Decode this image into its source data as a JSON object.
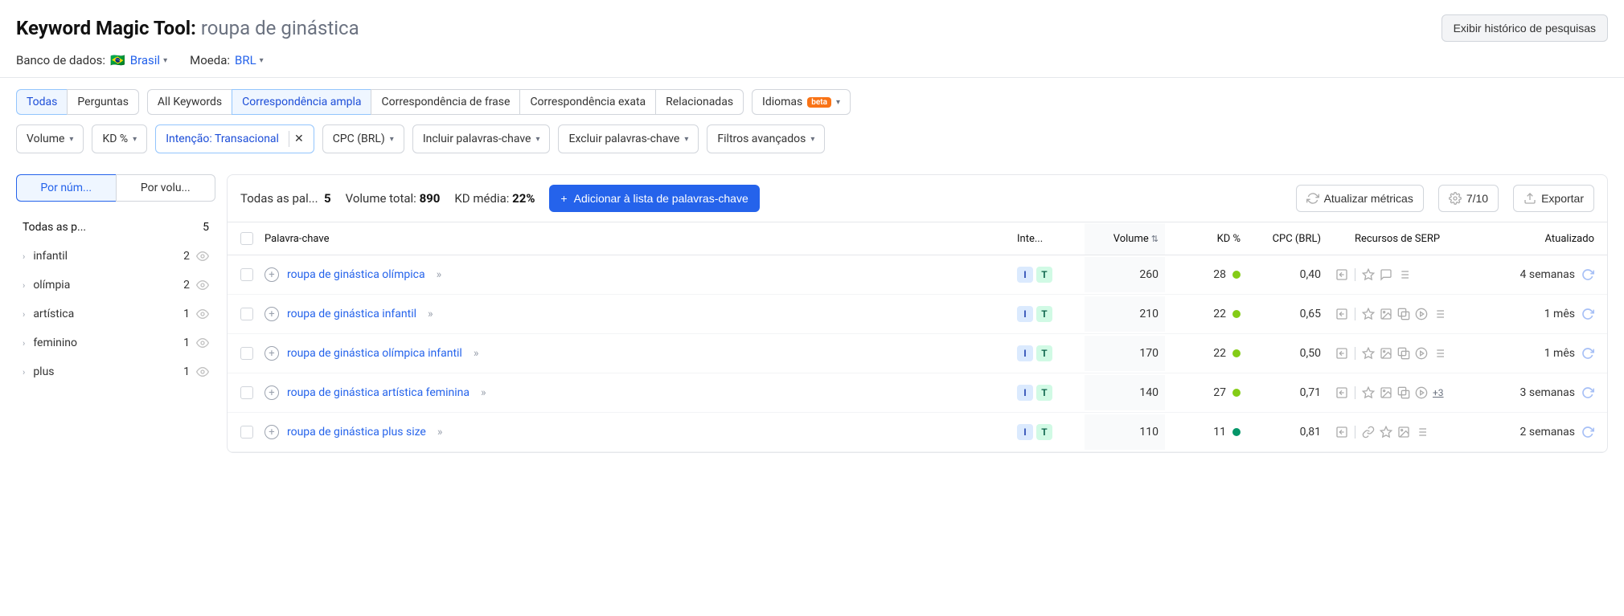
{
  "header": {
    "tool_name": "Keyword Magic Tool:",
    "query": "roupa de ginástica",
    "history_button": "Exibir histórico de pesquisas",
    "db_label": "Banco de dados:",
    "db_value": "Brasil",
    "db_flag": "🇧🇷",
    "currency_label": "Moeda:",
    "currency_value": "BRL"
  },
  "filter_tabs": {
    "todas": "Todas",
    "perguntas": "Perguntas",
    "all_keywords": "All Keywords",
    "ampla": "Correspondência ampla",
    "frase": "Correspondência de frase",
    "exata": "Correspondência exata",
    "relacionadas": "Relacionadas",
    "idiomas": "Idiomas",
    "beta": "beta"
  },
  "filters2": {
    "volume": "Volume",
    "kd": "KD %",
    "intent": "Intenção: Transacional",
    "cpc": "CPC (BRL)",
    "include": "Incluir palavras-chave",
    "exclude": "Excluir palavras-chave",
    "advanced": "Filtros avançados"
  },
  "sidebar": {
    "sort_num": "Por núm...",
    "sort_vol": "Por volu...",
    "all_label": "Todas as p...",
    "all_count": "5",
    "cats": [
      {
        "name": "infantil",
        "count": "2"
      },
      {
        "name": "olímpia",
        "count": "2"
      },
      {
        "name": "artística",
        "count": "1"
      },
      {
        "name": "feminino",
        "count": "1"
      },
      {
        "name": "plus",
        "count": "1"
      }
    ]
  },
  "toolbar": {
    "all_label": "Todas as pal...",
    "all_val": "5",
    "vol_label": "Volume total:",
    "vol_val": "890",
    "kd_label": "KD média:",
    "kd_val": "22%",
    "add": "Adicionar à lista de palavras-chave",
    "update": "Atualizar métricas",
    "counter": "7/10",
    "export": "Exportar"
  },
  "columns": {
    "keyword": "Palavra-chave",
    "intent": "Inte...",
    "volume": "Volume",
    "kd": "KD %",
    "cpc": "CPC (BRL)",
    "serp": "Recursos de SERP",
    "updated": "Atualizado"
  },
  "rows": [
    {
      "kw": "roupa de ginástica olímpica",
      "vol": "260",
      "kd": "28",
      "kd_color": "#84cc16",
      "cpc": "0,40",
      "serp": [
        "view",
        "star",
        "chat",
        "list"
      ],
      "upd": "4 semanas"
    },
    {
      "kw": "roupa de ginástica infantil",
      "vol": "210",
      "kd": "22",
      "kd_color": "#84cc16",
      "cpc": "0,65",
      "serp": [
        "view",
        "star",
        "img",
        "img2",
        "play",
        "list"
      ],
      "upd": "1 mês"
    },
    {
      "kw": "roupa de ginástica olímpica infantil",
      "vol": "170",
      "kd": "22",
      "kd_color": "#84cc16",
      "cpc": "0,50",
      "serp": [
        "view",
        "star",
        "img",
        "img2",
        "play",
        "list"
      ],
      "upd": "1 mês"
    },
    {
      "kw": "roupa de ginástica artística feminina",
      "vol": "140",
      "kd": "27",
      "kd_color": "#84cc16",
      "cpc": "0,71",
      "serp": [
        "view",
        "star",
        "img",
        "img2",
        "play"
      ],
      "more": "+3",
      "upd": "3 semanas"
    },
    {
      "kw": "roupa de ginástica plus size",
      "vol": "110",
      "kd": "11",
      "kd_color": "#059669",
      "cpc": "0,81",
      "serp": [
        "view",
        "link",
        "star",
        "img",
        "list"
      ],
      "upd": "2 semanas"
    }
  ]
}
